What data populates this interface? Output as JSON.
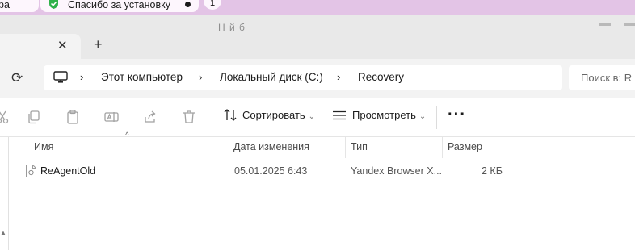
{
  "browser": {
    "tab_left_fragment": "ра",
    "tab_thanks_title": "Спасибо за установку",
    "tab_count": "1",
    "colors": {
      "strip": "#e3c4e6",
      "tab": "#fdf6fd",
      "shield": "#2fb14a"
    }
  },
  "explorer": {
    "ghost_title": "Н          й б",
    "tab_close": "✕",
    "new_tab": "+",
    "refresh_glyph": "⟳",
    "breadcrumb": {
      "sep": "›",
      "items": [
        "Этот компьютер",
        "Локальный диск (C:)",
        "Recovery"
      ]
    },
    "search_placeholder": "Поиск в: R",
    "toolbar": {
      "icons": [
        "cut-icon",
        "copy-icon",
        "paste-icon",
        "rename-icon",
        "share-icon",
        "delete-icon"
      ],
      "sort_label": "Сортировать",
      "view_label": "Просмотреть",
      "caret": "⌄",
      "more": "···"
    },
    "columns": [
      "Имя",
      "Дата изменения",
      "Тип",
      "Размер"
    ],
    "sort_arrow": "^",
    "files": [
      {
        "name": "ReAgentOld",
        "modified": "05.01.2025 6:43",
        "type": "Yandex Browser X...",
        "size": "2 КБ"
      }
    ]
  }
}
